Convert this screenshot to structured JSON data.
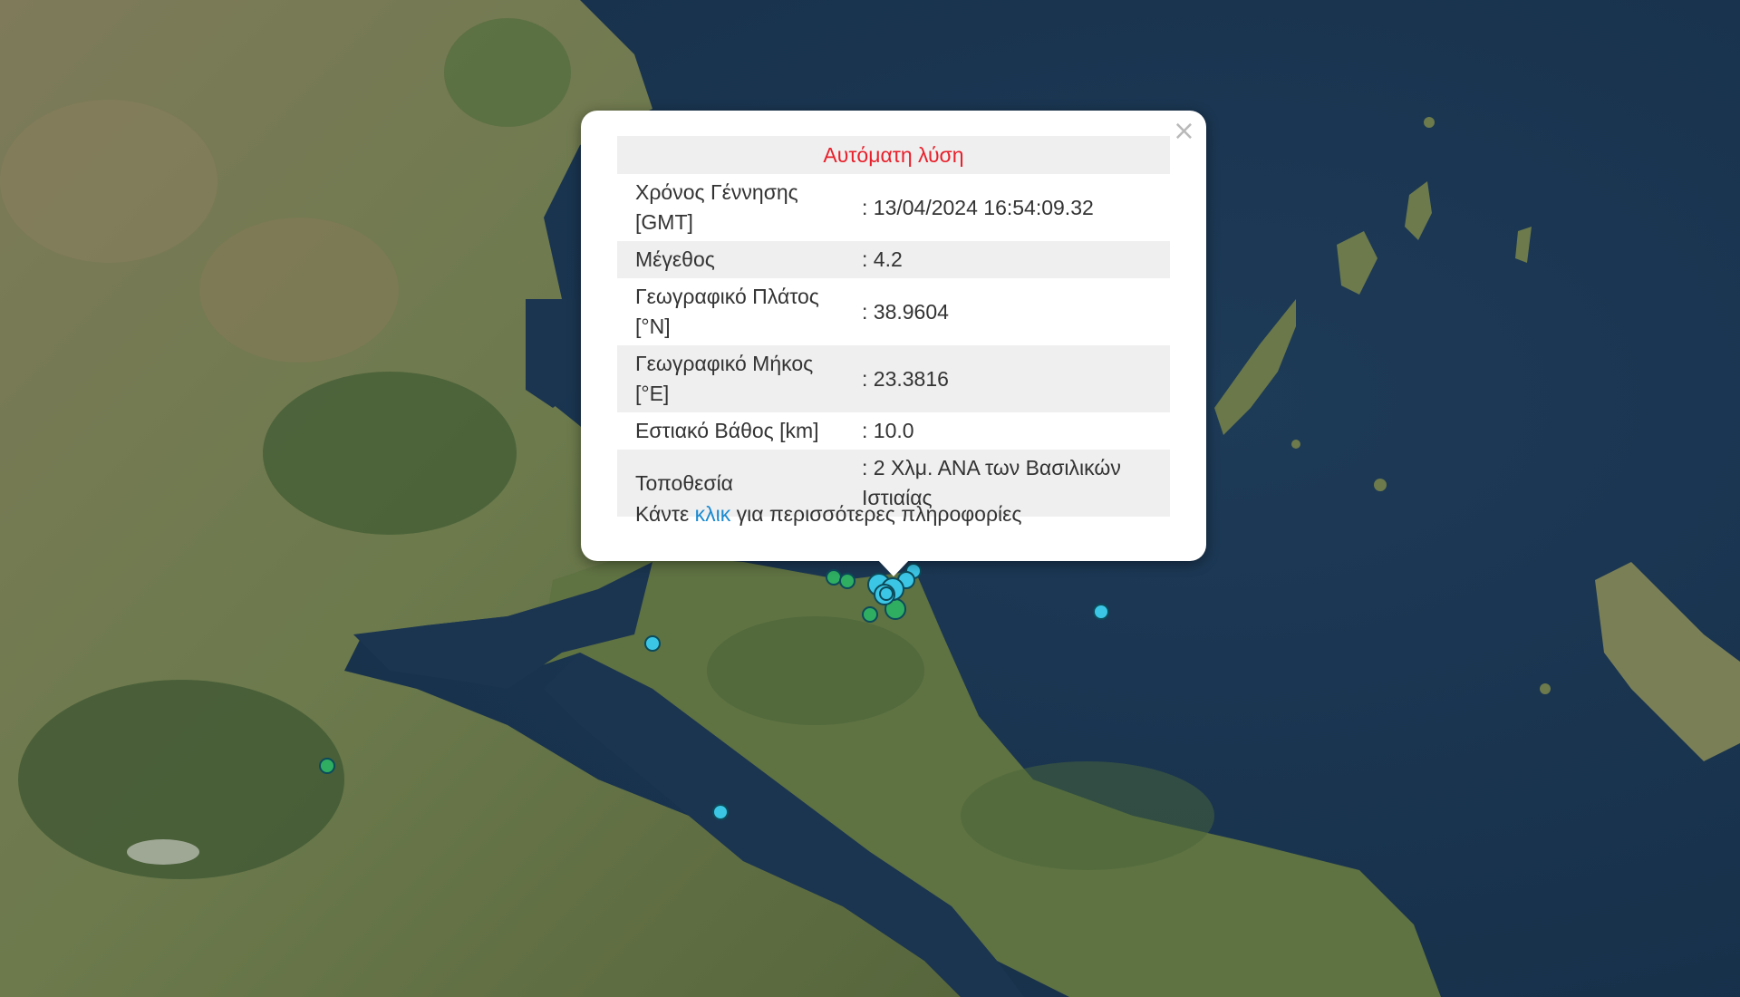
{
  "popup": {
    "title": "Αυτόματη λύση",
    "close_symbol": "×",
    "rows": [
      {
        "label": "Χρόνος Γέννησης [GMT]",
        "value": ": 13/04/2024 16:54:09.32"
      },
      {
        "label": "Μέγεθος",
        "value": ": 4.2"
      },
      {
        "label": "Γεωγραφικό Πλάτος [°N]",
        "value": ": 38.9604"
      },
      {
        "label": "Γεωγραφικό Μήκος [°E]",
        "value": ": 23.3816"
      },
      {
        "label": "Εστιακό Βάθος [km]",
        "value": ": 10.0"
      },
      {
        "label": "Τοποθεσία",
        "value": ": 2 Χλμ. ΑΝΑ των Βασιλικών Ιστιαίας"
      }
    ],
    "more_prefix": "Κάντε ",
    "more_link": "κλικ",
    "more_suffix": " για περισσότερες πληροφορίες"
  },
  "map": {
    "marker_colors": {
      "cyan": "#3cc6e6",
      "green": "#2fae62"
    },
    "map_colors": {
      "sea": "#1b3550",
      "land": "#6a7a4e",
      "forest": "#3e5a32"
    }
  }
}
